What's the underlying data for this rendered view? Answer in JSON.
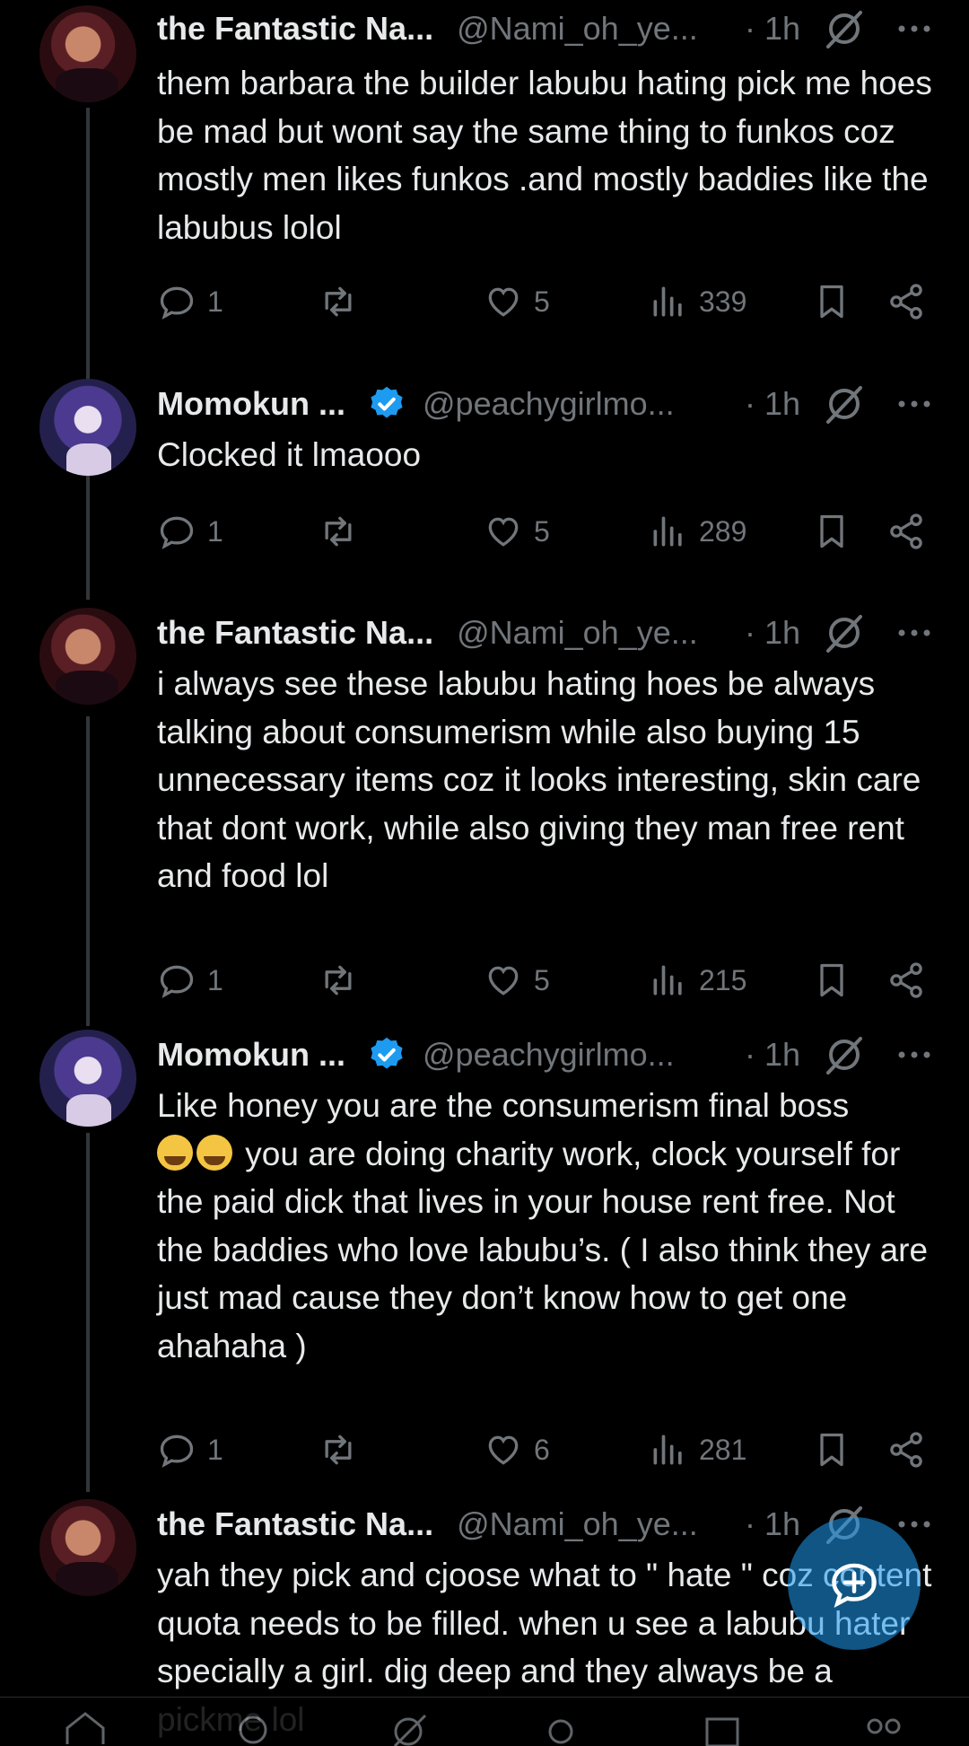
{
  "tweets": [
    {
      "name": "the Fantastic Na...",
      "handle": "@Nami_oh_ye...",
      "time": "· 1h",
      "text": "them barbara the builder labubu hating pick me hoes be mad but wont say the same thing to funkos coz mostly men likes funkos .and mostly baddies like the labubus lolol",
      "replies": "1",
      "likes": "5",
      "views": "339"
    },
    {
      "name": "Momokun ...",
      "handle": "@peachygirlmo...",
      "time": "· 1h",
      "text": "Clocked it lmaooo",
      "replies": "1",
      "likes": "5",
      "views": "289"
    },
    {
      "name": "the Fantastic Na...",
      "handle": "@Nami_oh_ye...",
      "time": "· 1h",
      "text": "i always see these labubu hating hoes be always talking  about consumerism while also buying 15 unnecessary items coz it looks interesting, skin care that dont work, while also giving they man free rent and food lol",
      "replies": "1",
      "likes": "5",
      "views": "215"
    },
    {
      "name": "Momokun ...",
      "handle": "@peachygirlmo...",
      "time": "· 1h",
      "text_before_emoji": "Like honey you are the consumerism final boss",
      "text": "you are doing charity work, clock yourself for the paid dick that lives in your house rent free. Not the baddies who love labubu’s. ( I also think they are just mad cause they don’t know how to get one ahahaha )",
      "emoji": [
        "loudly-crying-face",
        "tears-of-joy-face"
      ],
      "replies": "1",
      "likes": "6",
      "views": "281"
    },
    {
      "name": "the Fantastic Na...",
      "handle": "@Nami_oh_ye...",
      "time": "· 1h",
      "text": "yah they pick and cjoose what to \" hate \" coz content quota needs to be filled. when u see a labubu hater specially a girl. dig deep and they always be a pickme lol"
    }
  ],
  "icons": {
    "reply": "reply-icon",
    "retweet": "retweet-icon",
    "like": "heart-icon",
    "views": "views-icon",
    "bookmark": "bookmark-icon",
    "share": "share-icon",
    "grok": "grok-icon",
    "more": "more-icon",
    "compose": "compose-icon"
  },
  "colors": {
    "background": "#000000",
    "text": "#e7e9ea",
    "muted": "#71767b",
    "verified": "#1d9bf0"
  }
}
